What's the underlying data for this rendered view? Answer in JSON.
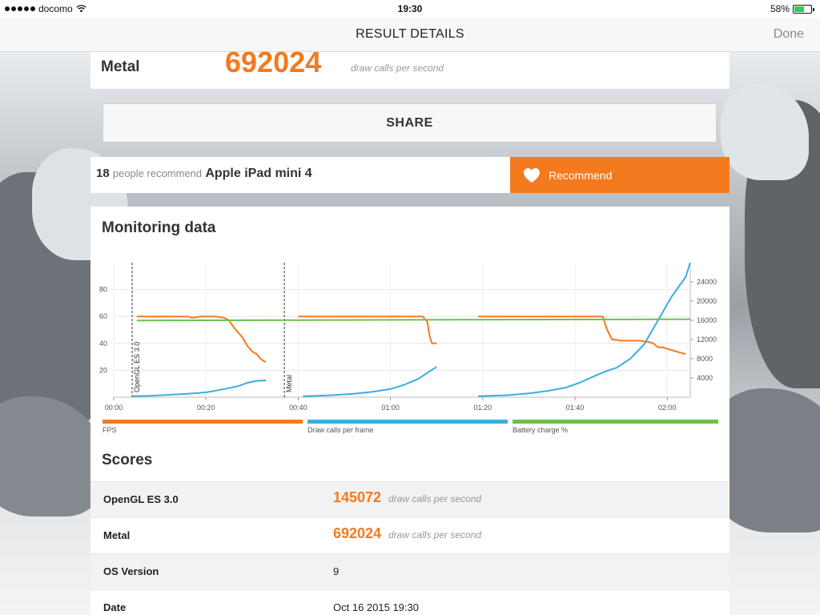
{
  "status_bar": {
    "carrier": "docomo",
    "time": "19:30",
    "battery": "58%",
    "battery_level": 0.58
  },
  "nav": {
    "title": "RESULT DETAILS",
    "done": "Done"
  },
  "metal_summary": {
    "label": "Metal",
    "score": "692024",
    "unit": "draw calls per second"
  },
  "share": {
    "label": "SHARE"
  },
  "recommend": {
    "count": "18",
    "text": "people recommend",
    "device": "Apple iPad mini 4",
    "button": "Recommend"
  },
  "monitoring": {
    "title": "Monitoring data"
  },
  "scores": {
    "title": "Scores",
    "rows": [
      {
        "label": "OpenGL ES 3.0",
        "value": "145072",
        "unit": "draw calls per second"
      },
      {
        "label": "Metal",
        "value": "692024",
        "unit": "draw calls per second"
      },
      {
        "label": "OS Version",
        "value": "9"
      },
      {
        "label": "Date",
        "value": "Oct 16 2015 19:30"
      }
    ]
  },
  "colors": {
    "fps": "#f47a20",
    "draw_calls": "#3aaee0",
    "battery": "#6cc04a",
    "accent": "#f47a20"
  },
  "chart_data": {
    "type": "line",
    "x_ticks": [
      "00:00",
      "00:20",
      "00:40",
      "01:00",
      "01:20",
      "01:40",
      "02:00"
    ],
    "y_left_ticks": [
      "20",
      "40",
      "60",
      "80"
    ],
    "y_right_ticks": [
      "4000",
      "8000",
      "12000",
      "16000",
      "20000",
      "24000"
    ],
    "y_left_range": [
      0,
      100
    ],
    "y_right_range": [
      0,
      28000
    ],
    "x_range_seconds": [
      0,
      125
    ],
    "markers": [
      {
        "label": "OpenGL ES 3.0",
        "x": 4
      },
      {
        "label": "Metal",
        "x": 37
      }
    ],
    "series": [
      {
        "name": "FPS",
        "axis": "left",
        "segments": [
          [
            [
              5,
              60
            ],
            [
              11,
              60
            ],
            [
              16,
              60
            ],
            [
              17,
              59
            ],
            [
              19,
              60
            ],
            [
              22,
              60
            ],
            [
              24,
              59
            ],
            [
              25,
              57
            ],
            [
              26,
              52
            ],
            [
              28,
              44
            ],
            [
              29,
              38
            ],
            [
              30,
              34
            ],
            [
              31,
              32
            ],
            [
              32,
              28
            ],
            [
              33,
              26
            ]
          ],
          [
            [
              40,
              60
            ],
            [
              50,
              60
            ],
            [
              60,
              60
            ],
            [
              67,
              60
            ],
            [
              68,
              56
            ],
            [
              68.5,
              45
            ],
            [
              69,
              40
            ],
            [
              70,
              40
            ]
          ],
          [
            [
              79,
              60
            ],
            [
              90,
              60
            ],
            [
              100,
              60
            ],
            [
              106,
              60
            ],
            [
              107,
              50
            ],
            [
              108,
              43
            ],
            [
              110,
              42
            ],
            [
              114,
              42
            ],
            [
              116,
              41
            ],
            [
              117,
              40
            ],
            [
              118,
              37
            ],
            [
              119,
              37
            ],
            [
              120,
              36
            ],
            [
              122,
              34
            ],
            [
              124,
              32
            ]
          ]
        ]
      },
      {
        "name": "Draw calls per frame",
        "axis": "right",
        "segments": [
          [
            [
              4,
              200
            ],
            [
              8,
              300
            ],
            [
              12,
              500
            ],
            [
              16,
              700
            ],
            [
              20,
              1000
            ],
            [
              24,
              1700
            ],
            [
              27,
              2300
            ],
            [
              29,
              3000
            ],
            [
              31,
              3400
            ],
            [
              33,
              3500
            ]
          ],
          [
            [
              41,
              200
            ],
            [
              47,
              400
            ],
            [
              52,
              700
            ],
            [
              56,
              1100
            ],
            [
              60,
              1700
            ],
            [
              63,
              2600
            ],
            [
              66,
              3800
            ],
            [
              69,
              5700
            ],
            [
              70,
              6300
            ]
          ],
          [
            [
              79,
              200
            ],
            [
              85,
              400
            ],
            [
              90,
              800
            ],
            [
              94,
              1300
            ],
            [
              98,
              2000
            ],
            [
              101,
              3000
            ],
            [
              104,
              4300
            ],
            [
              107,
              5500
            ],
            [
              109,
              6100
            ],
            [
              112,
              8000
            ],
            [
              115,
              11000
            ],
            [
              118,
              16000
            ],
            [
              121,
              21000
            ],
            [
              124,
              25000
            ],
            [
              125,
              28000
            ]
          ]
        ]
      },
      {
        "name": "Battery charge %",
        "axis": "left",
        "segments": [
          [
            [
              5,
              57
            ],
            [
              125,
              58
            ]
          ]
        ]
      }
    ]
  }
}
